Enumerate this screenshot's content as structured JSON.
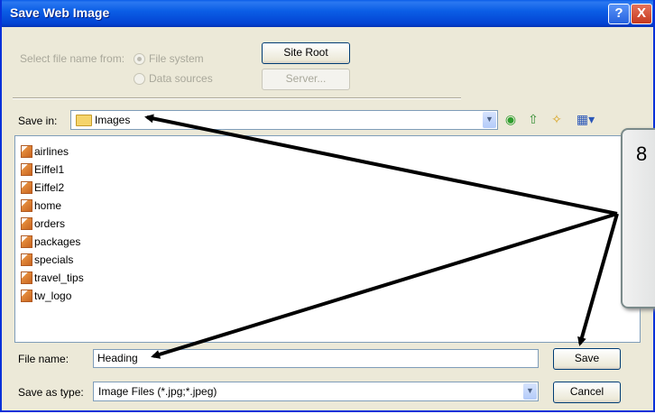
{
  "window": {
    "title": "Save Web Image",
    "help_label": "?",
    "close_label": "X"
  },
  "options": {
    "select_from_label": "Select file name from:",
    "radio_file_system": "File system",
    "radio_data_sources": "Data sources",
    "site_root_label": "Site Root",
    "server_label": "Server..."
  },
  "save_in": {
    "label": "Save in:",
    "value": "Images",
    "icons": [
      "back-icon",
      "up-folder-icon",
      "new-folder-icon",
      "view-menu-icon"
    ]
  },
  "files": [
    "airlines",
    "Eiffel1",
    "Eiffel2",
    "home",
    "orders",
    "packages",
    "specials",
    "travel_tips",
    "tw_logo"
  ],
  "file_name": {
    "label": "File name:",
    "value": "Heading"
  },
  "save_as_type": {
    "label": "Save as type:",
    "value": "Image Files (*.jpg;*.jpeg)"
  },
  "buttons": {
    "save": "Save",
    "cancel": "Cancel"
  },
  "callout": {
    "text": "8"
  },
  "colors": {
    "titlebar": "#0b5ee6",
    "dialog_bg": "#ece9d8",
    "border_blue": "#7f9db9"
  }
}
